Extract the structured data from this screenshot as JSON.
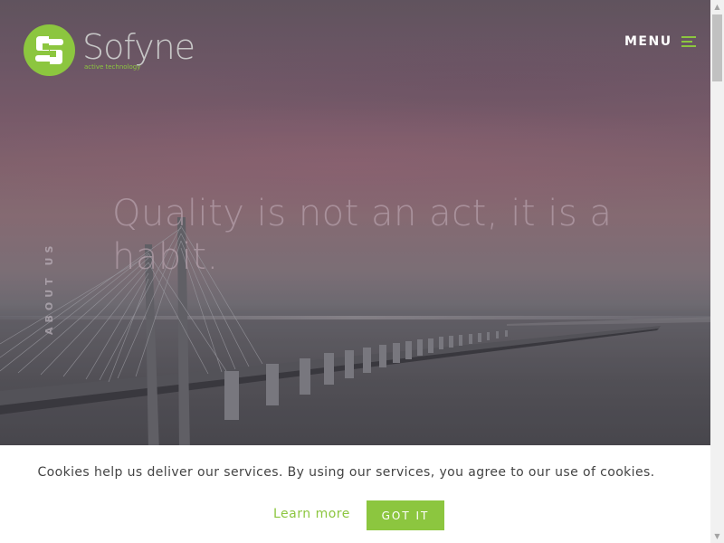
{
  "header": {
    "brand_name": "Sofyne",
    "brand_tagline": "active technology",
    "menu_label": "MENU"
  },
  "hero": {
    "headline": "Quality is not an act, it is a habit.",
    "side_label": "ABOUT US"
  },
  "cookie_banner": {
    "message": "Cookies help us deliver our services. By using our services, you agree to our use of cookies.",
    "learn_more_label": "Learn more",
    "accept_label": "GOT IT"
  },
  "colors": {
    "brand_green": "#8cc63f",
    "logo_text_gray": "#c7c7c7",
    "cookie_bg": "#ffffff",
    "cookie_text": "#444444"
  },
  "icons": {
    "menu": "hamburger-icon",
    "scroll_up": "arrow-up-icon",
    "scroll_down": "arrow-down-icon"
  }
}
